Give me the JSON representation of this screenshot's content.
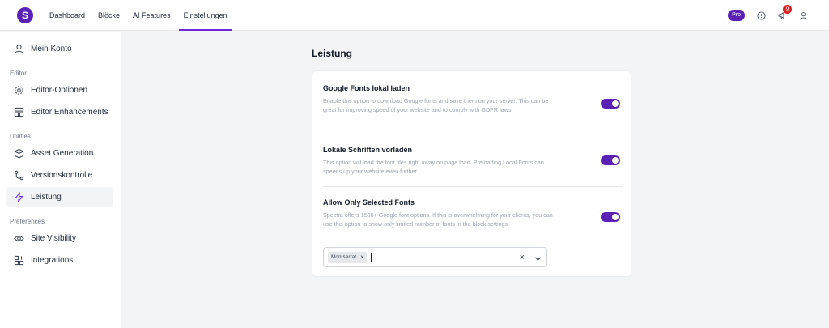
{
  "header": {
    "logo": "S",
    "nav": [
      {
        "label": "Dashboard"
      },
      {
        "label": "Blöcke"
      },
      {
        "label": "AI Features"
      },
      {
        "label": "Einstellungen",
        "active": true
      }
    ],
    "pro_badge": "Pro",
    "notification_count": "9",
    "icons": [
      "help-circle-icon",
      "megaphone-icon",
      "user-icon"
    ]
  },
  "sidebar": {
    "items": [
      {
        "label": "Mein Konto",
        "icon": "user-icon"
      },
      {
        "label": "Editor-Optionen",
        "icon": "gear-icon"
      },
      {
        "label": "Editor Enhancements",
        "icon": "layout-icon"
      },
      {
        "label": "Asset Generation",
        "icon": "cube-icon"
      },
      {
        "label": "Versionskontrolle",
        "icon": "git-branch-icon"
      },
      {
        "label": "Leistung",
        "icon": "lightning-icon",
        "active": true
      },
      {
        "label": "Site Visibility",
        "icon": "eye-icon"
      },
      {
        "label": "Integrations",
        "icon": "grid-plus-icon"
      }
    ],
    "sections": [
      "Editor",
      "Utilities",
      "Preferences"
    ]
  },
  "main": {
    "title": "Leistung",
    "settings": [
      {
        "title": "Google Fonts lokal laden",
        "description": "Enable this option to download Google fonts and save them on your server. This can be great for improving speed of your website and to comply with GDPR laws.",
        "enabled": true
      },
      {
        "title": "Lokale Schriften vorladen",
        "description": "This option will load the font files right away on page load. Preloading Local Fonts can speeds up your website even further.",
        "enabled": true
      },
      {
        "title": "Allow Only Selected Fonts",
        "description": "Spectra offers 1500+ Google font options. If this is overwhelming for your clients, you can use this option to show only limited number of fonts in the block settings.",
        "enabled": true
      }
    ],
    "font_select": {
      "selected": [
        "Montserrat"
      ],
      "chip_remove": "×",
      "clear": "×"
    }
  },
  "colors": {
    "accent": "#5b21b6",
    "badge_red": "#dc2626",
    "background": "#f3f4f6"
  }
}
